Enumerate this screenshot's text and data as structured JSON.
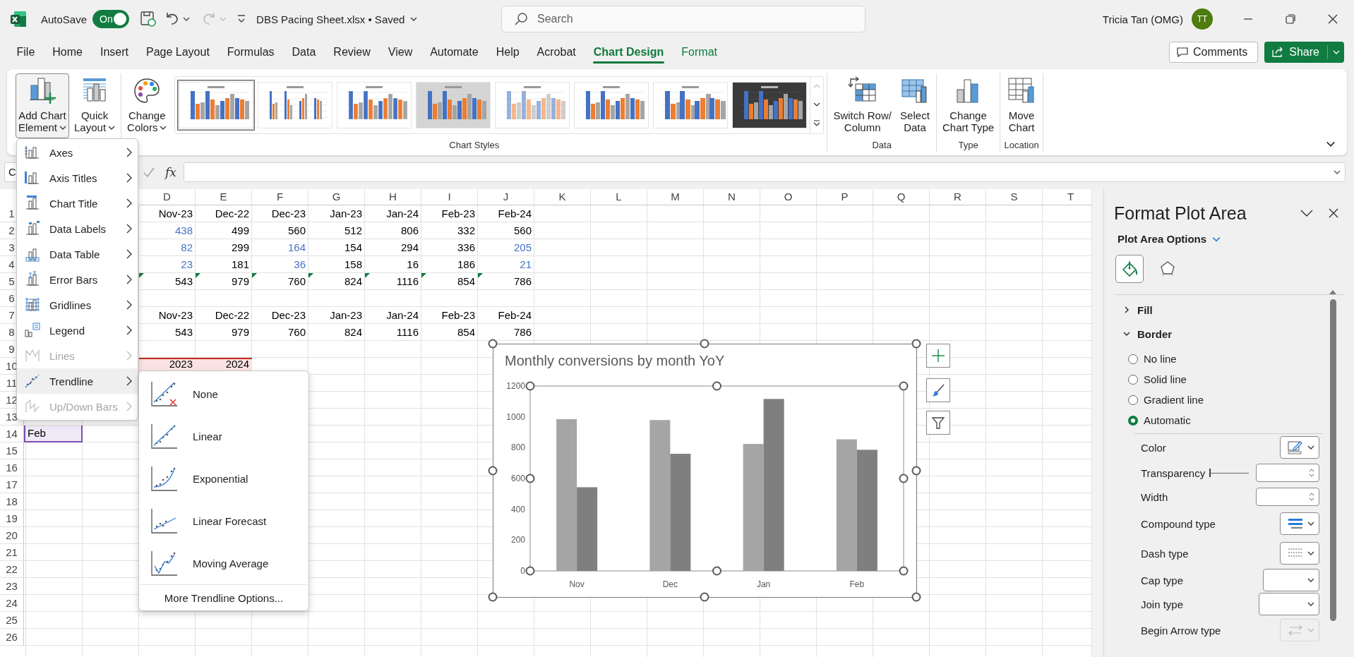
{
  "title_bar": {
    "autosave_label": "AutoSave",
    "autosave": {
      "label": "On",
      "on": true
    },
    "document_title": "DBS Pacing Sheet.xlsx • Saved",
    "search": {
      "placeholder": "Search"
    },
    "user_name": "Tricia Tan (OMG)",
    "user_initials": "TT"
  },
  "tabs": [
    {
      "label": "File",
      "selected": false,
      "contextual": false
    },
    {
      "label": "Home",
      "selected": false,
      "contextual": false
    },
    {
      "label": "Insert",
      "selected": false,
      "contextual": false
    },
    {
      "label": "Page Layout",
      "selected": false,
      "contextual": false
    },
    {
      "label": "Formulas",
      "selected": false,
      "contextual": false
    },
    {
      "label": "Data",
      "selected": false,
      "contextual": false
    },
    {
      "label": "Review",
      "selected": false,
      "contextual": false
    },
    {
      "label": "View",
      "selected": false,
      "contextual": false
    },
    {
      "label": "Automate",
      "selected": false,
      "contextual": false
    },
    {
      "label": "Help",
      "selected": false,
      "contextual": false
    },
    {
      "label": "Acrobat",
      "selected": false,
      "contextual": false
    },
    {
      "label": "Chart Design",
      "selected": true,
      "contextual": true
    },
    {
      "label": "Format",
      "selected": false,
      "contextual": true
    }
  ],
  "comments_button": "Comments",
  "share_button": "Share",
  "ribbon": {
    "groups": [
      {
        "buttons": [
          {
            "kind": "add-element",
            "lines": [
              "Add Chart",
              "Element"
            ],
            "dropdown": true,
            "pressed": true
          },
          {
            "kind": "quick-layout",
            "lines": [
              "Quick",
              "Layout"
            ],
            "dropdown": true,
            "pressed": false
          }
        ]
      },
      {
        "label": "Chart Styles",
        "buttons": [
          {
            "kind": "colors",
            "lines": [
              "Change",
              "Colors"
            ],
            "dropdown": true,
            "pressed": false
          }
        ],
        "styles": [
          {
            "kind": "plain",
            "selected": true
          },
          {
            "kind": "thin",
            "selected": false
          },
          {
            "kind": "striped",
            "selected": false
          },
          {
            "kind": "shaded",
            "selected": false
          },
          {
            "kind": "outlined",
            "selected": false
          },
          {
            "kind": "plain",
            "selected": false
          },
          {
            "kind": "hatched",
            "selected": false
          },
          {
            "kind": "dark",
            "selected": false
          }
        ]
      },
      {
        "label": "Data",
        "buttons": [
          {
            "kind": "switch",
            "lines": [
              "Switch Row/",
              "Column"
            ],
            "dropdown": false,
            "pressed": false
          },
          {
            "kind": "select-data",
            "lines": [
              "Select",
              "Data"
            ],
            "dropdown": false,
            "pressed": false
          }
        ]
      },
      {
        "label": "Type",
        "buttons": [
          {
            "kind": "change-type",
            "lines": [
              "Change",
              "Chart Type"
            ],
            "dropdown": false,
            "pressed": false
          }
        ]
      },
      {
        "label": "Location",
        "buttons": [
          {
            "kind": "move",
            "lines": [
              "Move",
              "Chart"
            ],
            "dropdown": false,
            "pressed": false
          }
        ]
      }
    ]
  },
  "formula_bar": {
    "name_box": "C",
    "function_label": "fx"
  },
  "sheet": {
    "column_headers": [
      "D",
      "E",
      "F",
      "G",
      "H",
      "I",
      "J",
      "K",
      "L",
      "M",
      "N",
      "O",
      "P",
      "Q",
      "R",
      "S",
      "T"
    ],
    "rows": [
      {
        "number": "1",
        "cells": [
          null,
          null,
          {
            "text": "Nov-23"
          },
          {
            "text": "Dec-22"
          },
          {
            "text": "Dec-23"
          },
          {
            "text": "Jan-23"
          },
          {
            "text": "Jan-24"
          },
          {
            "text": "Feb-23"
          },
          {
            "text": "Feb-24"
          }
        ]
      },
      {
        "number": "2",
        "cells": [
          null,
          null,
          {
            "text": "438",
            "color": "#4472c4"
          },
          {
            "text": "499",
            "color": "#000000"
          },
          {
            "text": "560",
            "color": "#000000"
          },
          {
            "text": "512",
            "color": "#000000"
          },
          {
            "text": "806",
            "color": "#000000"
          },
          {
            "text": "332",
            "color": "#000000"
          },
          {
            "text": "560",
            "color": "#000000"
          }
        ]
      },
      {
        "number": "3",
        "cells": [
          null,
          null,
          {
            "text": "82",
            "color": "#4472c4"
          },
          {
            "text": "299",
            "color": "#000000"
          },
          {
            "text": "164",
            "color": "#4472c4"
          },
          {
            "text": "154",
            "color": "#000000"
          },
          {
            "text": "294",
            "color": "#000000"
          },
          {
            "text": "336",
            "color": "#000000"
          },
          {
            "text": "205",
            "color": "#4472c4"
          }
        ]
      },
      {
        "number": "4",
        "cells": [
          null,
          null,
          {
            "text": "23",
            "color": "#4472c4"
          },
          {
            "text": "181",
            "color": "#000000"
          },
          {
            "text": "36",
            "color": "#4472c4"
          },
          {
            "text": "158",
            "color": "#000000"
          },
          {
            "text": "16",
            "color": "#000000"
          },
          {
            "text": "186",
            "color": "#000000"
          },
          {
            "text": "21",
            "color": "#4472c4"
          }
        ]
      },
      {
        "number": "5",
        "cells": [
          null,
          null,
          {
            "text": "543",
            "flagged": true
          },
          {
            "text": "979",
            "flagged": true
          },
          {
            "text": "760",
            "flagged": true
          },
          {
            "text": "824",
            "flagged": true
          },
          {
            "text": "1116",
            "flagged": true
          },
          {
            "text": "854",
            "flagged": true
          },
          {
            "text": "786",
            "flagged": true
          }
        ]
      },
      {
        "number": "6"
      },
      {
        "number": "7",
        "cells": [
          null,
          null,
          {
            "text": "Nov-23"
          },
          {
            "text": "Dec-22"
          },
          {
            "text": "Dec-23"
          },
          {
            "text": "Jan-23"
          },
          {
            "text": "Jan-24"
          },
          {
            "text": "Feb-23"
          },
          {
            "text": "Feb-24"
          }
        ]
      },
      {
        "number": "8",
        "cells": [
          null,
          null,
          {
            "text": "543"
          },
          {
            "text": "979"
          },
          {
            "text": "760"
          },
          {
            "text": "824"
          },
          {
            "text": "1116"
          },
          {
            "text": "854"
          },
          {
            "text": "786"
          }
        ]
      },
      {
        "number": "9"
      },
      {
        "number": "10",
        "cells": [
          null,
          null,
          {
            "text": "2023",
            "highlighted": true
          },
          {
            "text": "2024",
            "highlighted": true
          }
        ]
      },
      {
        "number": "11"
      },
      {
        "number": "12"
      },
      {
        "number": "13"
      },
      {
        "number": "14",
        "cells": [
          {
            "text": "Feb",
            "kind": "text",
            "selected": true
          }
        ]
      },
      {
        "number": "15"
      },
      {
        "number": "16"
      },
      {
        "number": "17"
      },
      {
        "number": "18"
      },
      {
        "number": "19"
      },
      {
        "number": "20"
      },
      {
        "number": "21"
      },
      {
        "number": "22"
      },
      {
        "number": "23"
      },
      {
        "number": "24"
      },
      {
        "number": "25"
      },
      {
        "number": "26"
      }
    ]
  },
  "chart": {
    "chart_data": {
      "type": "bar",
      "title": "Monthly conversions by month YoY",
      "categories": [
        "Nov",
        "Dec",
        "Jan",
        "Feb"
      ],
      "series": [
        {
          "color": "#a5a5a5",
          "values": [
            985,
            979,
            824,
            854
          ]
        },
        {
          "color": "#7f7f7f",
          "values": [
            543,
            760,
            1116,
            786
          ]
        }
      ],
      "ylim": [
        0,
        1200
      ],
      "yticks": [
        0,
        200,
        400,
        600,
        800,
        1000,
        1200
      ]
    }
  },
  "add_chart_element_menu": [
    {
      "label": "Axes",
      "disabled": false,
      "expanded": false
    },
    {
      "label": "Axis Titles",
      "disabled": false,
      "expanded": false
    },
    {
      "label": "Chart Title",
      "disabled": false,
      "expanded": false
    },
    {
      "label": "Data Labels",
      "disabled": false,
      "expanded": false
    },
    {
      "label": "Data Table",
      "disabled": false,
      "expanded": false
    },
    {
      "label": "Error Bars",
      "disabled": false,
      "expanded": false
    },
    {
      "label": "Gridlines",
      "disabled": false,
      "expanded": false
    },
    {
      "label": "Legend",
      "disabled": false,
      "expanded": false
    },
    {
      "label": "Lines",
      "disabled": true,
      "expanded": false
    },
    {
      "label": "Trendline",
      "disabled": false,
      "expanded": true
    },
    {
      "label": "Up/Down Bars",
      "disabled": true,
      "expanded": false
    }
  ],
  "trendline_menu": {
    "items": [
      {
        "label": "None"
      },
      {
        "label": "Linear"
      },
      {
        "label": "Exponential"
      },
      {
        "label": "Linear Forecast"
      },
      {
        "label": "Moving Average"
      }
    ],
    "more_options": "More Trendline Options..."
  },
  "format_pane": {
    "title": "Format Plot Area",
    "options_label": "Plot Area Options",
    "tabs": [
      {
        "kind": "fill-line",
        "selected": true
      },
      {
        "kind": "effects",
        "selected": false
      }
    ],
    "sections": [
      {
        "label": "Fill",
        "expanded": false
      },
      {
        "label": "Border",
        "expanded": true
      }
    ],
    "border_options": [
      {
        "label": "No line",
        "selected": false
      },
      {
        "label": "Solid line",
        "selected": false
      },
      {
        "label": "Gradient line",
        "selected": false
      },
      {
        "label": "Automatic",
        "selected": true
      }
    ],
    "properties": [
      {
        "label": "Color",
        "kind": "color",
        "disabled": false
      },
      {
        "label": "Transparency",
        "kind": "slider-spin",
        "disabled": false,
        "level": 0
      },
      {
        "label": "Width",
        "kind": "spin",
        "disabled": false
      },
      {
        "label": "Compound type",
        "kind": "compound",
        "disabled": false
      },
      {
        "label": "Dash type",
        "kind": "dash",
        "disabled": false
      },
      {
        "label": "Cap type",
        "kind": "select",
        "disabled": false
      },
      {
        "label": "Join type",
        "kind": "select",
        "disabled": false
      },
      {
        "label": "Begin Arrow type",
        "kind": "arrow",
        "disabled": true
      }
    ]
  }
}
